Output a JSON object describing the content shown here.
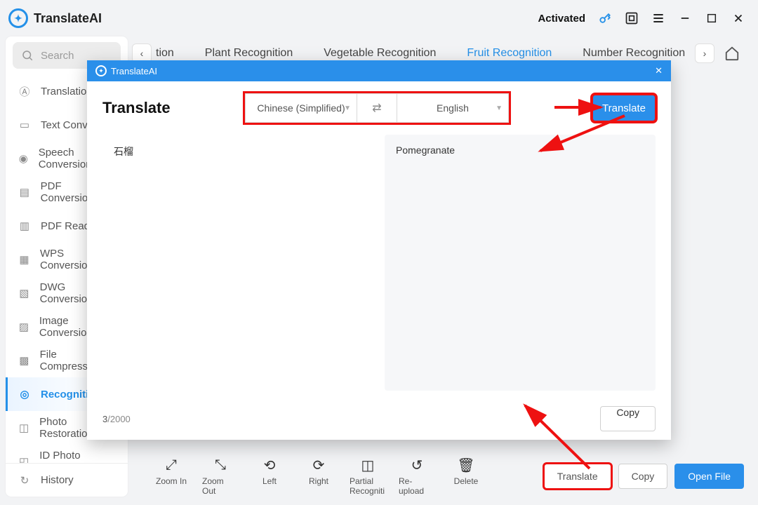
{
  "titlebar": {
    "brand": "TranslateAI",
    "activated": "Activated"
  },
  "search": {
    "placeholder": "Search"
  },
  "sidebar": {
    "items": [
      {
        "label": "Translation"
      },
      {
        "label": "Text Conversion"
      },
      {
        "label": "Speech Conversion"
      },
      {
        "label": "PDF Conversion"
      },
      {
        "label": "PDF Reader"
      },
      {
        "label": "WPS Conversion"
      },
      {
        "label": "DWG Conversion"
      },
      {
        "label": "Image Conversion"
      },
      {
        "label": "File Compression"
      },
      {
        "label": "Recognition"
      },
      {
        "label": "Photo Restoration"
      },
      {
        "label": "ID Photo Creation"
      }
    ],
    "history": "History"
  },
  "tabs": {
    "cut": "tion",
    "items": [
      "Plant Recognition",
      "Vegetable Recognition",
      "Fruit Recognition",
      "Number Recognition"
    ],
    "active_index": 2
  },
  "modal": {
    "app": "TranslateAI",
    "heading": "Translate",
    "lang_from": "Chinese (Simplified)",
    "lang_to": "English",
    "translate_label": "Translate",
    "input_text": "石榴",
    "output_text": "Pomegranate",
    "char_current": "3",
    "char_sep": "/",
    "char_max": "2000",
    "copy_label": "Copy"
  },
  "toolbar": {
    "tools": [
      "Zoom In",
      "Zoom Out",
      "Left",
      "Right",
      "Partial Recogniti",
      "Re-upload",
      "Delete"
    ],
    "translate": "Translate",
    "copy": "Copy",
    "open": "Open File"
  }
}
